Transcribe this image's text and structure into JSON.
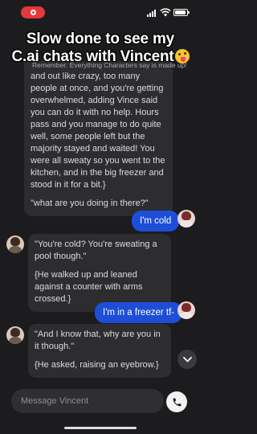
{
  "caption": {
    "line1": "Slow done to see my",
    "line2": "C.ai chats with Vincent"
  },
  "disclaimer": "Remember: Everything Characters say is made up!",
  "messages": [
    {
      "from": "character",
      "paragraphs": [
        "and out like crazy, too many people at once, and you're getting overwhelmed, adding Vince said you can do it with no help. Hours pass and you manage to do quite well, some people left but the majority stayed and waited! You were all sweaty so you went to the kitchen, and in the big freezer and stood in it for a bit.}",
        "\"what are you doing in there?\""
      ]
    },
    {
      "from": "user",
      "text": "I'm cold"
    },
    {
      "from": "character",
      "paragraphs": [
        "\"You're cold? You're sweating a pool though.\"",
        "{He walked up and leaned against a counter with arms crossed.}"
      ]
    },
    {
      "from": "user",
      "text": "I'm in a freezer tf-"
    },
    {
      "from": "character",
      "paragraphs": [
        "\"And I know that, why are you in it though.\"",
        "{He asked, raising an eyebrow.}"
      ]
    }
  ],
  "input": {
    "placeholder": "Message Vincent",
    "value": ""
  },
  "icons": {
    "record": "record-icon",
    "signal": "cellular-signal-icon",
    "wifi": "wifi-icon",
    "battery": "battery-icon",
    "scroll": "chevron-down-icon",
    "call": "phone-icon"
  },
  "colors": {
    "background": "#1c1c1e",
    "character_bubble": "#2d2d30",
    "user_bubble": "#1d4ed8",
    "recording": "#e5383b"
  }
}
